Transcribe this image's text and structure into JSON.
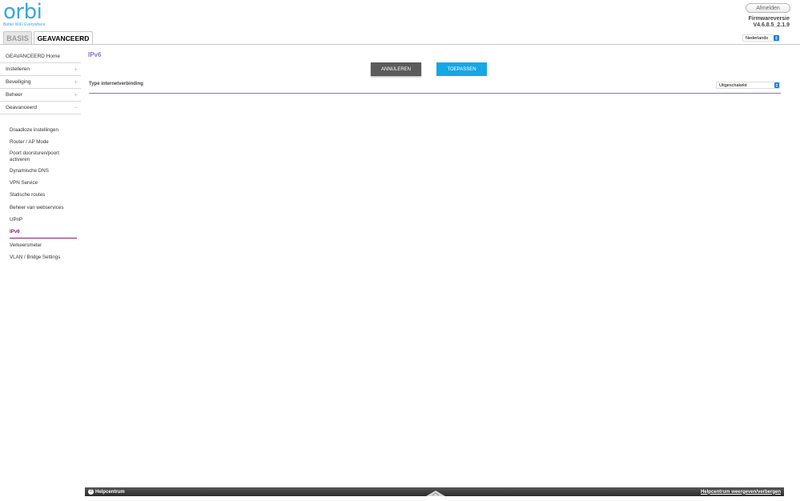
{
  "header": {
    "logo_text": "orbi",
    "tagline": "Better WiFi Everywhere",
    "logout_label": "Afmelden",
    "firmware_label": "Firmwareversie",
    "firmware_value": "V4.6.8.5_2.1.9",
    "language": "Nederlands"
  },
  "tabs": [
    {
      "label": "BASIS"
    },
    {
      "label": "GEAVANCEERD"
    }
  ],
  "sidebar": {
    "items": [
      {
        "label": "GEAVANCEERD Home",
        "sign": ""
      },
      {
        "label": "Instelleren",
        "sign": "+"
      },
      {
        "label": "Beveiliging",
        "sign": "+"
      },
      {
        "label": "Beheer",
        "sign": "+"
      },
      {
        "label": "Geavanceerd",
        "sign": "−"
      }
    ],
    "subitems": [
      {
        "label": "Draadloze instellingen"
      },
      {
        "label": "Router / AP Mode"
      },
      {
        "label": "Poort doorsturen/poort activeren"
      },
      {
        "label": "Dynamische DNS"
      },
      {
        "label": "VPN Service"
      },
      {
        "label": "Statische routes"
      },
      {
        "label": "Beheer van webservices"
      },
      {
        "label": "UPnP"
      },
      {
        "label": "IPv6"
      },
      {
        "label": "Verkeersmeter"
      },
      {
        "label": "VLAN / Bridge Settings"
      }
    ]
  },
  "main": {
    "title": "IPv6",
    "cancel_label": "ANNULEREN",
    "apply_label": "TOEPASSEN",
    "connection_type_label": "Type internetverbinding",
    "connection_type_value": "Uitgeschakeld"
  },
  "footer": {
    "help_label": "Helpcentrum",
    "toggle_label": "Helpcentrum weergeven/verbergen"
  },
  "colors": {
    "accent_blue": "#15a7e6",
    "title_purple": "#8a6fd8",
    "active_magenta": "#8a1a7a"
  }
}
